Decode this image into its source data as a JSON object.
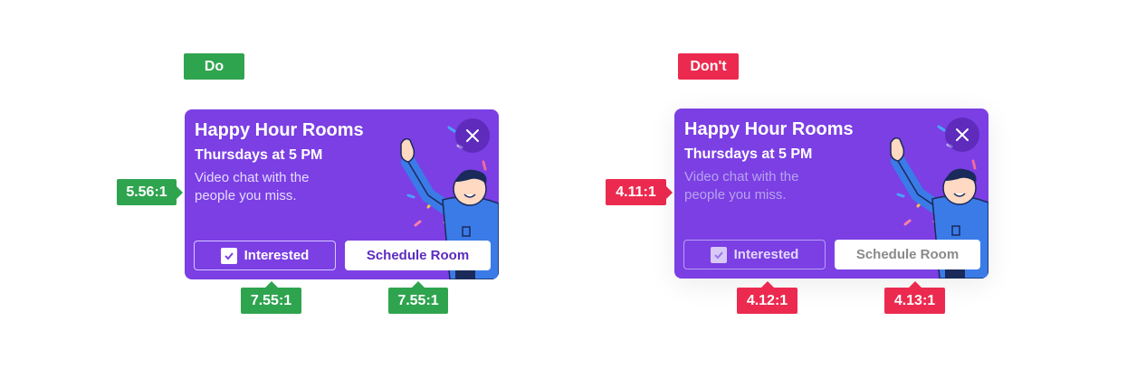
{
  "colors": {
    "good": "#2fa44f",
    "bad": "#ec2a4f",
    "card": "#7b3fe4"
  },
  "do_example": {
    "label": "Do",
    "card": {
      "title": "Happy Hour Rooms",
      "subtitle": "Thursdays at 5 PM",
      "description": "Video chat with the people you miss.",
      "interested_label": "Interested",
      "schedule_label": "Schedule Room"
    },
    "ratio_text": "5.56:1",
    "ratio_interested": "7.55:1",
    "ratio_schedule": "7.55:1"
  },
  "dont_example": {
    "label": "Don't",
    "card": {
      "title": "Happy Hour Rooms",
      "subtitle": "Thursdays at 5 PM",
      "description": "Video chat with the people you miss.",
      "interested_label": "Interested",
      "schedule_label": "Schedule Room"
    },
    "ratio_text": "4.11:1",
    "ratio_interested": "4.12:1",
    "ratio_schedule": "4.13:1"
  }
}
